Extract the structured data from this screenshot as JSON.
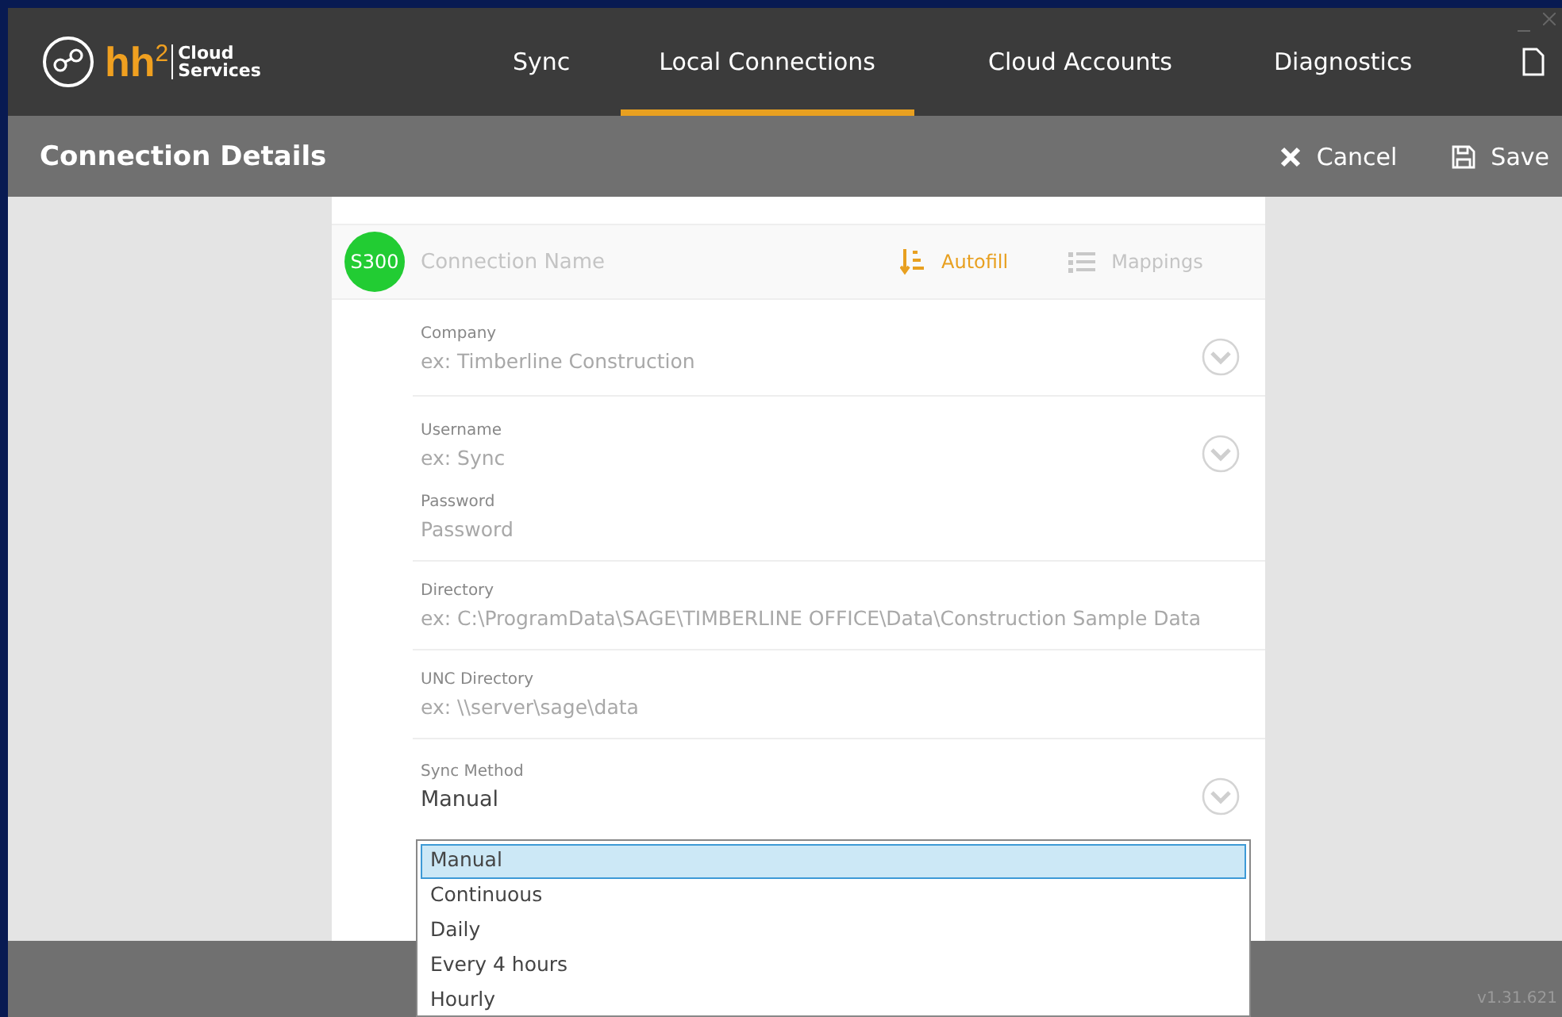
{
  "app": {
    "logo_text": "hh",
    "logo_sup": "2",
    "logo_sub1": "Cloud",
    "logo_sub2": "Services"
  },
  "tabs": [
    {
      "label": "Sync",
      "selected": false
    },
    {
      "label": "Local Connections",
      "selected": true
    },
    {
      "label": "Cloud Accounts",
      "selected": false
    },
    {
      "label": "Diagnostics",
      "selected": false
    }
  ],
  "subheader": {
    "title": "Connection Details",
    "cancel": "Cancel",
    "save": "Save"
  },
  "connection": {
    "badge": "S300",
    "name_placeholder": "Connection Name",
    "autofill": "Autofill",
    "mappings": "Mappings"
  },
  "groups": [
    {
      "fields": [
        {
          "label": "Company",
          "placeholder": "ex: Timberline Construction",
          "kind": "dropdown"
        }
      ]
    },
    {
      "fields": [
        {
          "label": "Username",
          "placeholder": "ex: Sync",
          "kind": "dropdown"
        },
        {
          "label": "Password",
          "placeholder": "Password",
          "kind": "text"
        }
      ]
    },
    {
      "fields": [
        {
          "label": "Directory",
          "placeholder": "ex: C:\\ProgramData\\SAGE\\TIMBERLINE OFFICE\\Data\\Construction Sample Data",
          "kind": "text"
        }
      ]
    },
    {
      "fields": [
        {
          "label": "UNC Directory",
          "placeholder": "ex: \\\\server\\sage\\data",
          "kind": "text"
        }
      ]
    },
    {
      "fields": [
        {
          "label": "Sync Method",
          "value": "Manual",
          "kind": "dropdown"
        }
      ]
    }
  ],
  "dropdown_options": [
    {
      "label": "Manual",
      "selected": true
    },
    {
      "label": "Continuous",
      "selected": false
    },
    {
      "label": "Daily",
      "selected": false
    },
    {
      "label": "Every 4 hours",
      "selected": false
    },
    {
      "label": "Hourly",
      "selected": false
    }
  ],
  "footer": {
    "version": "v1.31.621"
  }
}
